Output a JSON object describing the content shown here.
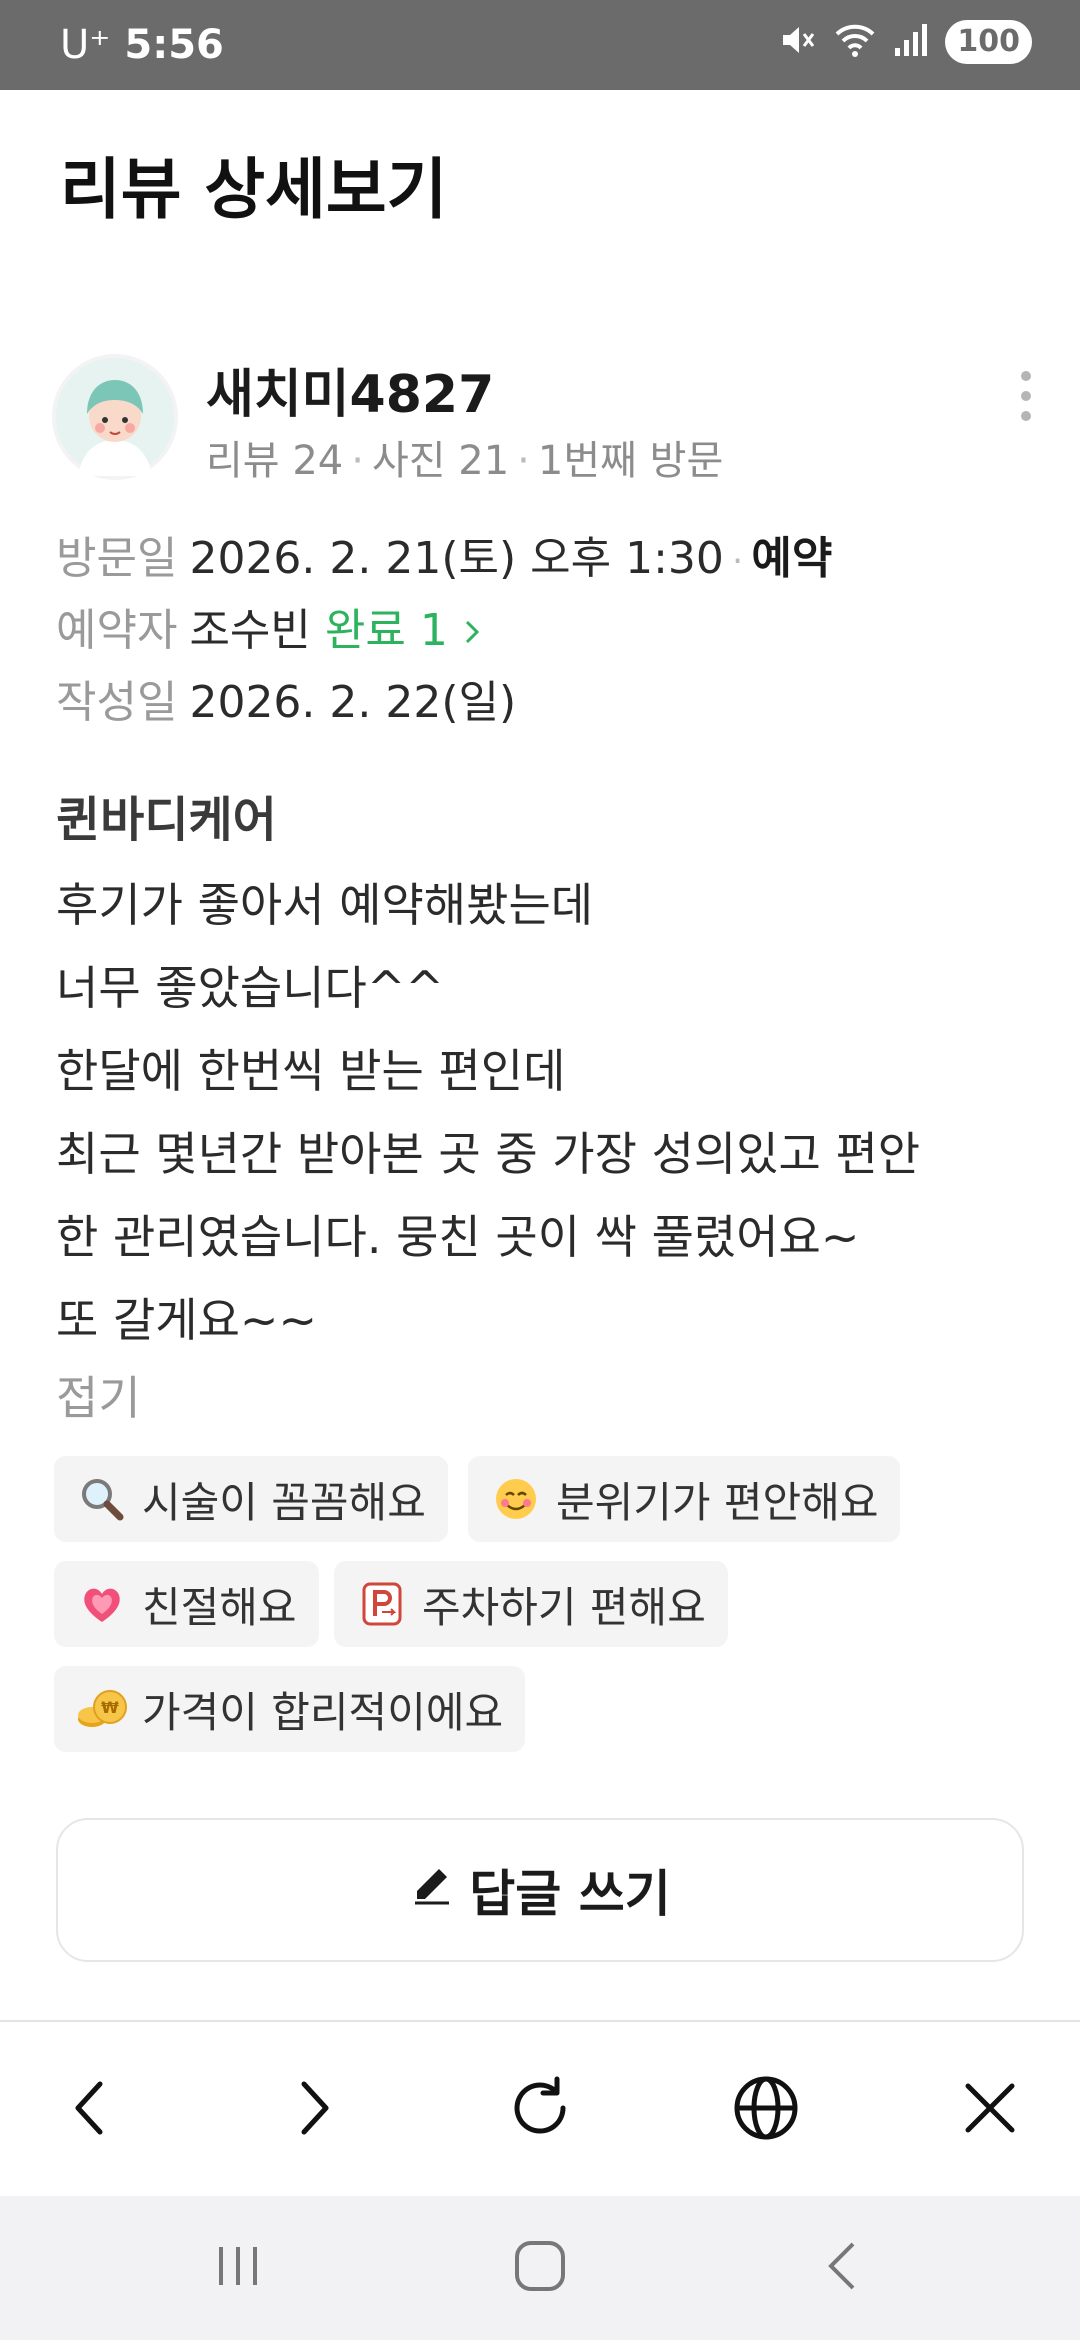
{
  "status_bar": {
    "carrier": "U⁺",
    "time": "5:56",
    "battery": "100"
  },
  "page_title": "리뷰 상세보기",
  "reviewer": {
    "nickname": "새치미4827",
    "stats": [
      "리뷰 24",
      "사진 21",
      "1번째 방문"
    ]
  },
  "visit": {
    "label": "방문일",
    "date": "2026. 2. 21(토) 오후 1:30",
    "badge": "예약"
  },
  "reserver": {
    "label": "예약자",
    "name": "조수빈",
    "status": "완료 1"
  },
  "written": {
    "label": "작성일",
    "date": "2026. 2. 22(일)"
  },
  "shop_name": "퀸바디케어",
  "review_lines": [
    "후기가 좋아서 예약해봤는데",
    "너무 좋았습니다^^",
    "한달에 한번씩 받는 편인데",
    "최근 몇년간 받아본 곳 중 가장 성의있고 편안",
    "한 관리였습니다. 뭉친 곳이 싹 풀렸어요~",
    "또 갈게요~~"
  ],
  "fold_label": "접기",
  "keywords": [
    {
      "label": "시술이 꼼꼼해요",
      "icon": "magnifier-icon"
    },
    {
      "label": "분위기가 편안해요",
      "icon": "smiling-face-icon"
    },
    {
      "label": "친절해요",
      "icon": "heart-icon"
    },
    {
      "label": "주차하기 편해요",
      "icon": "parking-icon"
    },
    {
      "label": "가격이 합리적이에요",
      "icon": "coin-icon"
    }
  ],
  "reply_button": "답글 쓰기",
  "colors": {
    "accent_green": "#2db35d",
    "chip_bg": "#f4f4f4",
    "status_bar": "#6b6b6b"
  }
}
